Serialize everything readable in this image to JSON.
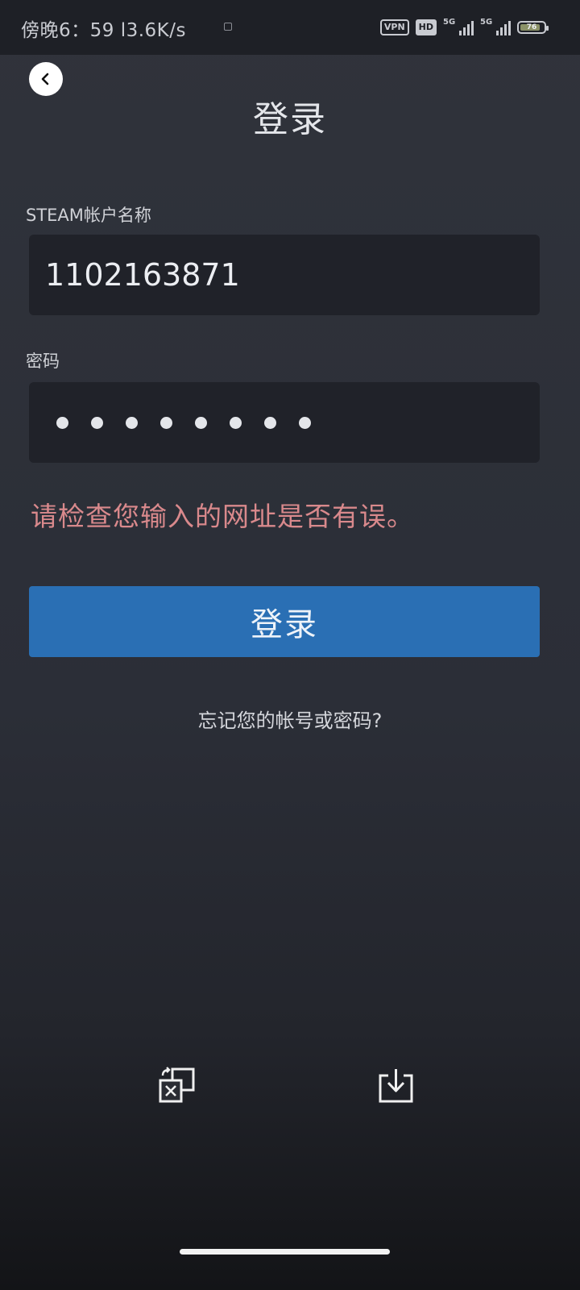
{
  "status_bar": {
    "time": "傍晚6：59 l3.6K/s",
    "vpn": "VPN",
    "hd": "HD",
    "signal_1": "5G",
    "signal_2": "5G",
    "battery": "76"
  },
  "page": {
    "title": "登录"
  },
  "form": {
    "username_label": "STEAM帐户名称",
    "username_value": "1102163871",
    "password_label": "密码",
    "password_masked_length": 8,
    "error_message": "请检查您输入的网址是否有误。",
    "login_button": "登录",
    "forgot_link": "忘记您的帐号或密码?"
  },
  "bottom_toolbar": {
    "icons": [
      "translate-icon",
      "download-icon"
    ]
  },
  "colors": {
    "background": "#2d3038",
    "input_background": "#202229",
    "accent_button": "#2a6fb4",
    "error_text": "#d9898c"
  }
}
